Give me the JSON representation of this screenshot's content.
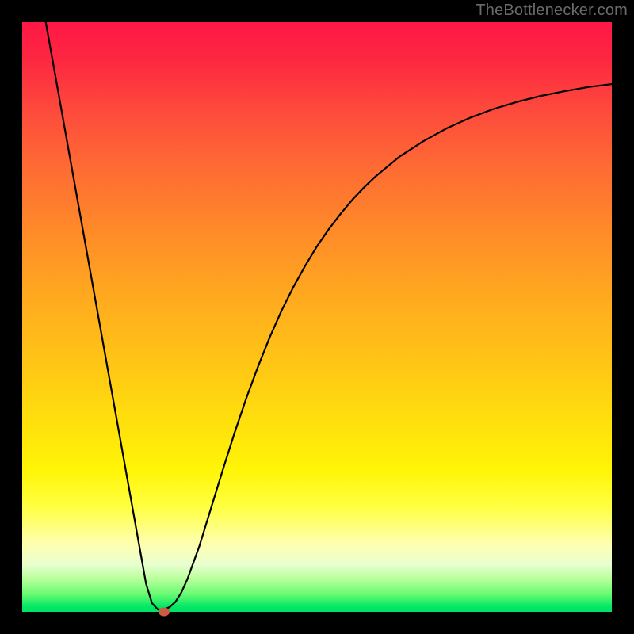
{
  "watermark": {
    "text": "TheBottlenecker.com"
  },
  "chart_data": {
    "type": "line",
    "title": "",
    "xlabel": "",
    "ylabel": "",
    "xlim": [
      0,
      100
    ],
    "ylim": [
      0,
      100
    ],
    "x": [
      4,
      6,
      8,
      10,
      12,
      14,
      16,
      18,
      20,
      21,
      22,
      23,
      24,
      25,
      26,
      27,
      28,
      30,
      32,
      34,
      36,
      38,
      40,
      42,
      44,
      46,
      48,
      50,
      52,
      54,
      56,
      58,
      60,
      64,
      68,
      72,
      76,
      80,
      84,
      88,
      92,
      96,
      100
    ],
    "values": [
      100,
      88.8,
      77.6,
      66.4,
      55.2,
      44.0,
      32.8,
      21.6,
      10.4,
      4.8,
      1.5,
      0.4,
      0.4,
      0.8,
      1.7,
      3.3,
      5.5,
      11.0,
      17.5,
      24.0,
      30.3,
      36.2,
      41.6,
      46.6,
      51.1,
      55.1,
      58.7,
      62.0,
      64.9,
      67.5,
      69.9,
      72.0,
      73.9,
      77.2,
      79.8,
      82.0,
      83.8,
      85.3,
      86.5,
      87.5,
      88.3,
      89.0,
      89.5
    ],
    "marker": {
      "x": 24.0,
      "y": 0.0
    },
    "gradient_stops": [
      {
        "pct": 0,
        "color": "#ff1846"
      },
      {
        "pct": 15,
        "color": "#fd4a3c"
      },
      {
        "pct": 36,
        "color": "#ff8c28"
      },
      {
        "pct": 58,
        "color": "#ffc615"
      },
      {
        "pct": 76,
        "color": "#fff506"
      },
      {
        "pct": 88.5,
        "color": "#feffb0"
      },
      {
        "pct": 97,
        "color": "#68fb72"
      },
      {
        "pct": 100,
        "color": "#00e364"
      }
    ]
  }
}
